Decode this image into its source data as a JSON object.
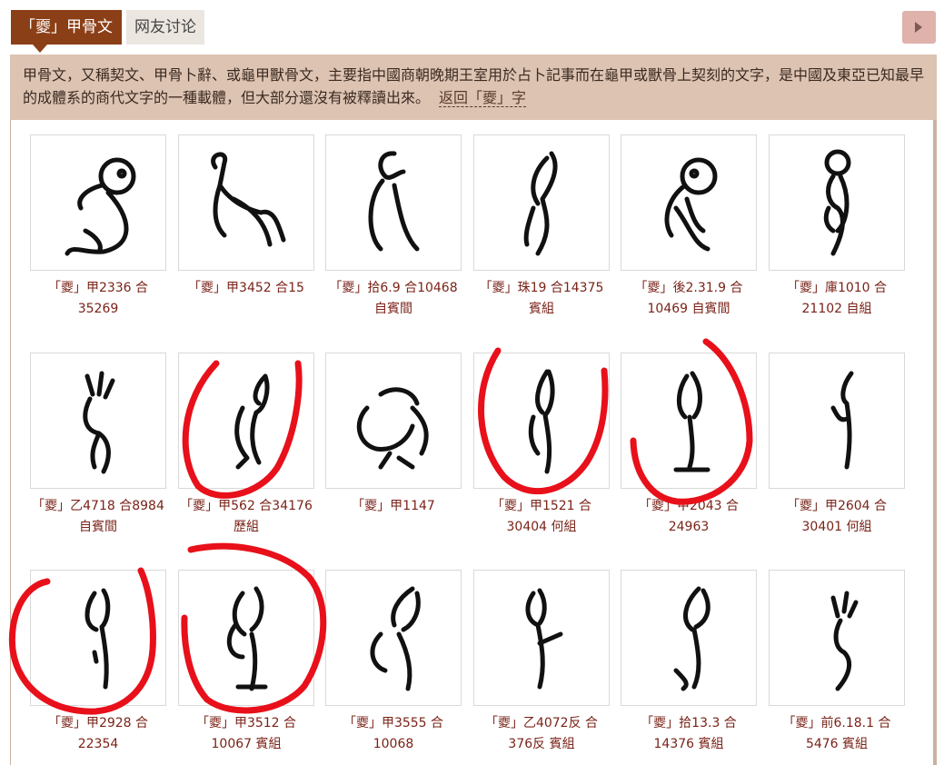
{
  "tabs": [
    {
      "label": "「夒」甲骨文",
      "active": true
    },
    {
      "label": "网友讨论",
      "active": false
    }
  ],
  "description": {
    "text": "甲骨文，又稱契文、甲骨卜辭、或龜甲獸骨文，主要指中國商朝晚期王室用於占卜記事而在龜甲或獸骨上契刻的文字，是中國及東亞已知最早的成體系的商代文字的一種載體，但大部分還沒有被釋讀出來。",
    "back_link": "返回「夒」字"
  },
  "glyphs": [
    {
      "caption": "「夒」甲2336 合35269"
    },
    {
      "caption": "「夒」甲3452 合15"
    },
    {
      "caption": "「夒」拾6.9 合10468 自賓間"
    },
    {
      "caption": "「夒」珠19 合14375 賓組"
    },
    {
      "caption": "「夒」後2.31.9 合10469 自賓間"
    },
    {
      "caption": "「夒」庫1010 合21102 自組"
    },
    {
      "caption": "「夒」乙4718 合8984 自賓間"
    },
    {
      "caption": "「夒」甲562 合34176 歷組"
    },
    {
      "caption": "「夒」甲1147"
    },
    {
      "caption": "「夒」甲1521 合30404 何組"
    },
    {
      "caption": "「夒」甲2043 合24963"
    },
    {
      "caption": "「夒」甲2604 合30401 何組"
    },
    {
      "caption": "「夒」甲2928 合22354"
    },
    {
      "caption": "「夒」甲3512 合10067 賓組"
    },
    {
      "caption": "「夒」甲3555 合10068"
    },
    {
      "caption": "「夒」乙4072反 合376反 賓組"
    },
    {
      "caption": "「夒」拾13.3 合14376 賓組"
    },
    {
      "caption": "「夒」前6.18.1 合5476 賓組"
    }
  ],
  "colors": {
    "accent": "#8b3f17",
    "caption": "#7a2318",
    "description_bg": "#dcc3b2",
    "annotation": "#e8101a"
  },
  "icons": {
    "next": "caret-right-icon"
  }
}
